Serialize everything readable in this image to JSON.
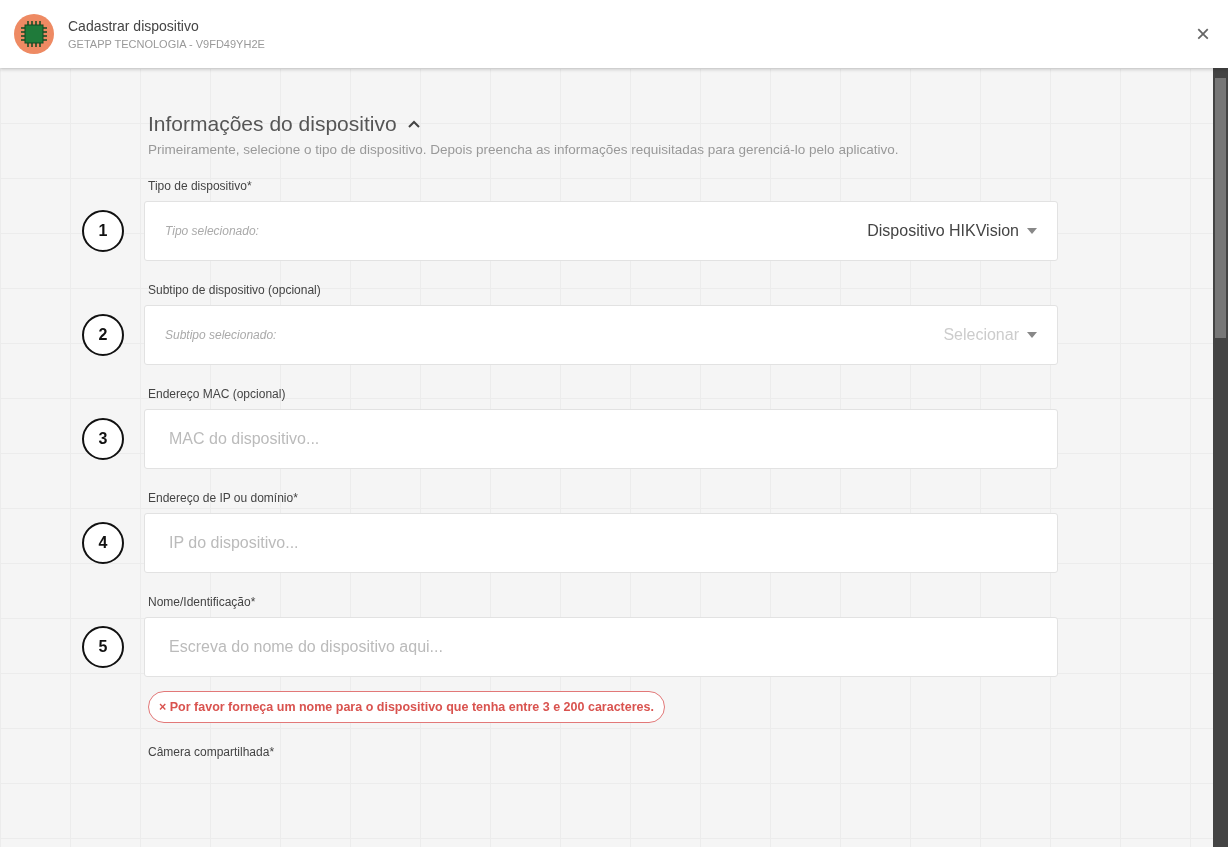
{
  "header": {
    "title": "Cadastrar dispositivo",
    "subtitle": "GETAPP TECNOLOGIA - V9FD49YH2E",
    "close": "×"
  },
  "section": {
    "title": "Informações do dispositivo",
    "expanded": true,
    "description": "Primeiramente, selecione o tipo de dispositivo. Depois preencha as informações requisitadas para gerenciá-lo pelo aplicativo."
  },
  "fields": [
    {
      "kind": "select",
      "number": "1",
      "label": "Tipo de dispositivo*",
      "prefix": "Tipo selecionado:",
      "value": "Dispositivo HIKVision"
    },
    {
      "kind": "select",
      "number": "2",
      "label": "Subtipo de dispositivo (opcional)",
      "prefix": "Subtipo selecionado:",
      "placeholder": "Selecionar"
    },
    {
      "kind": "input",
      "number": "3",
      "label": "Endereço MAC (opcional)",
      "placeholder": "MAC do dispositivo..."
    },
    {
      "kind": "input",
      "number": "4",
      "label": "Endereço de IP ou domínio*",
      "placeholder": "IP do dispositivo..."
    },
    {
      "kind": "input",
      "number": "5",
      "label": "Nome/Identificação*",
      "placeholder": "Escreva do nome do dispositivo aqui...",
      "error": "× Por favor forneça um nome para o dispositivo que tenha entre 3 e 200 caracteres."
    },
    {
      "kind": "label",
      "label": "Câmera compartilhada*"
    }
  ]
}
